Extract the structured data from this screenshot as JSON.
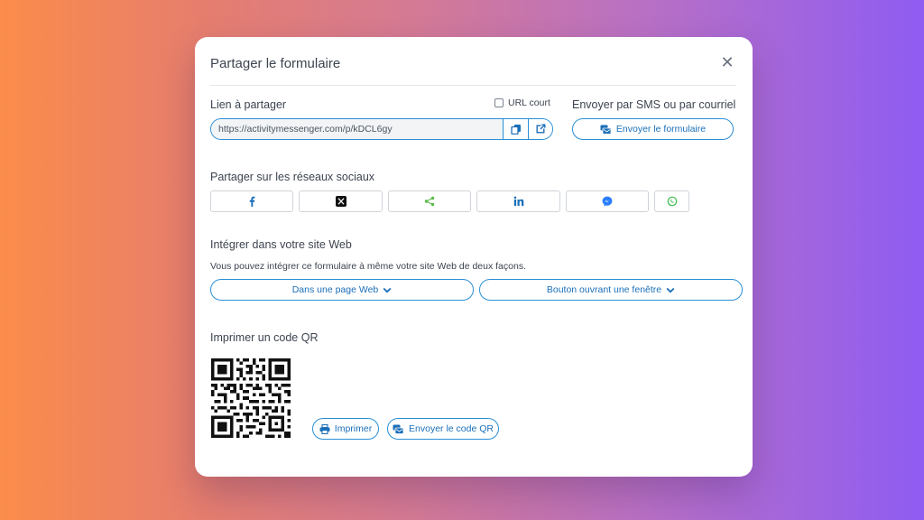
{
  "modal": {
    "title": "Partager le formulaire"
  },
  "link": {
    "label": "Lien à partager",
    "url": "https://activitymessenger.com/p/kDCL6gy",
    "short_url_label": "URL court",
    "short_url_checked": false
  },
  "sms": {
    "label": "Envoyer par SMS ou par courriel",
    "button_label": "Envoyer le formulaire"
  },
  "social": {
    "label": "Partager sur les réseaux sociaux",
    "icons": [
      "facebook-icon",
      "x-icon",
      "share-icon",
      "linkedin-icon",
      "messenger-icon",
      "whatsapp-icon"
    ]
  },
  "embed": {
    "label": "Intégrer dans votre site Web",
    "description": "Vous pouvez intégrer ce formulaire à même votre site Web de deux façons.",
    "option1": "Dans une page Web",
    "option2": "Bouton ouvrant une fenêtre"
  },
  "qr": {
    "label": "Imprimer un code QR",
    "print_label": "Imprimer",
    "send_label": "Envoyer le code QR"
  },
  "colors": {
    "accent": "#2a8fd6",
    "accent_text": "#1b6fb8",
    "share_green": "#5bb94a",
    "whatsapp_green": "#3fbf4f",
    "messenger_blue": "#2b7fff"
  }
}
